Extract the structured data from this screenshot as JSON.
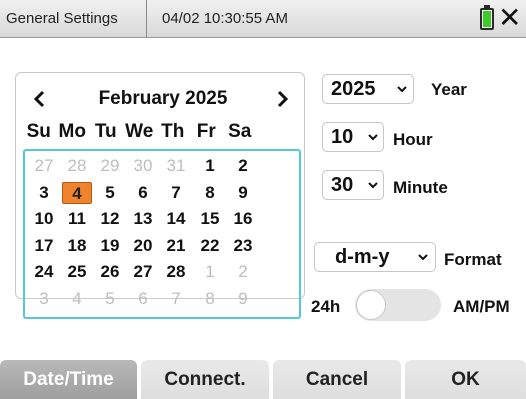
{
  "titlebar": {
    "title": "General Settings",
    "datetime": "04/02 10:30:55 AM",
    "battery_icon": "battery-icon",
    "close_icon": "close-icon",
    "battery_color": "#3dcb28"
  },
  "calendar": {
    "month_label": "February 2025",
    "weekdays": [
      "Su",
      "Mo",
      "Tu",
      "We",
      "Th",
      "Fr",
      "Sa"
    ],
    "selected_color": "#f0842c",
    "accent_color": "#55c8d6",
    "weeks": [
      [
        {
          "d": "27",
          "muted": true
        },
        {
          "d": "28",
          "muted": true
        },
        {
          "d": "29",
          "muted": true
        },
        {
          "d": "30",
          "muted": true
        },
        {
          "d": "31",
          "muted": true
        },
        {
          "d": "1"
        },
        {
          "d": "2"
        }
      ],
      [
        {
          "d": "3"
        },
        {
          "d": "4",
          "selected": true
        },
        {
          "d": "5"
        },
        {
          "d": "6"
        },
        {
          "d": "7"
        },
        {
          "d": "8"
        },
        {
          "d": "9"
        }
      ],
      [
        {
          "d": "10"
        },
        {
          "d": "11"
        },
        {
          "d": "12"
        },
        {
          "d": "13"
        },
        {
          "d": "14"
        },
        {
          "d": "15"
        },
        {
          "d": "16"
        }
      ],
      [
        {
          "d": "17"
        },
        {
          "d": "18"
        },
        {
          "d": "19"
        },
        {
          "d": "20"
        },
        {
          "d": "21"
        },
        {
          "d": "22"
        },
        {
          "d": "23"
        }
      ],
      [
        {
          "d": "24"
        },
        {
          "d": "25"
        },
        {
          "d": "26"
        },
        {
          "d": "27"
        },
        {
          "d": "28"
        },
        {
          "d": "1",
          "muted": true
        },
        {
          "d": "2",
          "muted": true
        }
      ],
      [
        {
          "d": "3",
          "muted": true
        },
        {
          "d": "4",
          "muted": true
        },
        {
          "d": "5",
          "muted": true
        },
        {
          "d": "6",
          "muted": true
        },
        {
          "d": "7",
          "muted": true
        },
        {
          "d": "8",
          "muted": true
        },
        {
          "d": "9",
          "muted": true
        }
      ]
    ]
  },
  "controls": {
    "year": {
      "value": "2025",
      "label": "Year"
    },
    "hour": {
      "value": "10",
      "label": "Hour"
    },
    "minute": {
      "value": "30",
      "label": "Minute"
    },
    "format": {
      "value": "d-m-y",
      "label": "Format"
    },
    "clock": {
      "left_label": "24h",
      "right_label": "AM/PM",
      "toggled_on": false
    }
  },
  "tabs": [
    {
      "label": "Date/Time",
      "active": true
    },
    {
      "label": "Connect."
    },
    {
      "label": "Cancel"
    },
    {
      "label": "OK"
    }
  ]
}
